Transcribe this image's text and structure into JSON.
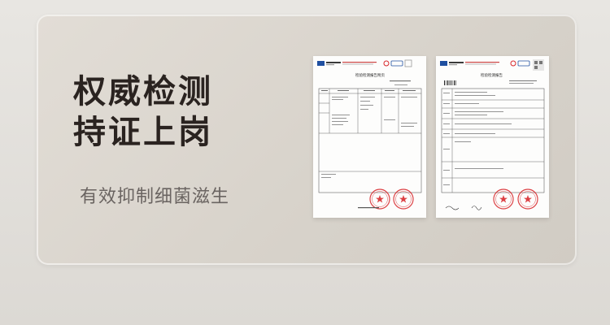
{
  "headline": {
    "line1": "权威检测",
    "line2": "持证上岗"
  },
  "subline": "有效抑制细菌滋生",
  "documents": [
    {
      "title": "检验检测报告附页",
      "type": "report-appendix"
    },
    {
      "title": "检验检测报告",
      "type": "report-cover"
    }
  ],
  "colors": {
    "background": "#e5e2de",
    "card": "#dcd7cf",
    "headline": "#2a2320",
    "subline": "#6a6461",
    "stamp": "#d8262a",
    "logo": "#1f4fa0"
  }
}
